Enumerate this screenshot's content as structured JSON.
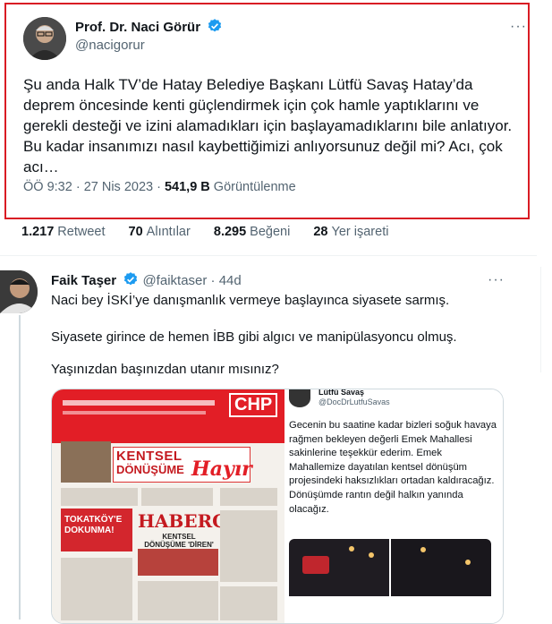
{
  "main_tweet": {
    "author_name": "Prof. Dr. Naci Görür",
    "author_handle": "@nacigorur",
    "text": "Şu anda Halk TV’de Hatay Belediye Başkanı Lütfü Savaş Hatay’da deprem öncesinde kenti güçlendirmek için çok hamle yaptıklarını ve gerekli desteği ve izini alamadıkları için başlayamadıklarını bile anlatıyor. Bu kadar insanımızı nasıl kaybettiğimizi anlıyorsunuz değil mi? Acı, çok acı…",
    "time": "ÖÖ 9:32 · 27 Nis 2023 · ",
    "views_count": "541,9 B",
    "views_label": "Görüntülenme",
    "more": "···"
  },
  "stats": [
    {
      "count": "1.217",
      "label": "Retweet"
    },
    {
      "count": "70",
      "label": "Alıntılar"
    },
    {
      "count": "8.295",
      "label": "Beğeni"
    },
    {
      "count": "28",
      "label": "Yer işareti"
    }
  ],
  "reply": {
    "author_name": "Faik Taşer",
    "author_handle": "@faiktaser",
    "age": "· 44d",
    "more": "···",
    "lines": [
      "Naci bey İSKİ’ye danışmanlık vermeye başlayınca siyasete sarmış.",
      "Siyasete girince de hemen İBB gibi algıcı ve manipülasyoncu olmuş.",
      "Yaşınızdan başınızdan utanır mısınız?"
    ]
  },
  "media": {
    "newspaper": {
      "chp": "CHP",
      "headline1": "KENTSEL",
      "headline2": "DÖNÜŞÜME",
      "hayir": "Hayır",
      "red_box": "TOKATKÖY'E DOKUNMA!",
      "haberci": "HABERCİ",
      "sub_headline": "KENTSEL DÖNÜŞÜME 'DİREN'"
    },
    "embedded_tweet": {
      "author_name": "Lütfü Savaş",
      "author_handle": "@DocDrLutfuSavas",
      "text": "Gecenin bu saatine kadar bizleri soğuk havaya rağmen bekleyen değerli Emek Mahallesi sakinlerine teşekkür ederim. Emek Mahallemize dayatılan kentsel dönüşüm projesindeki haksızlıkları ortadan kaldıracağız. Dönüşümde rantın değil halkın yanında olacağız."
    }
  },
  "colors": {
    "highlight_border": "#d91c24",
    "verified": "#1d9bf0",
    "secondary_text": "#536471"
  }
}
